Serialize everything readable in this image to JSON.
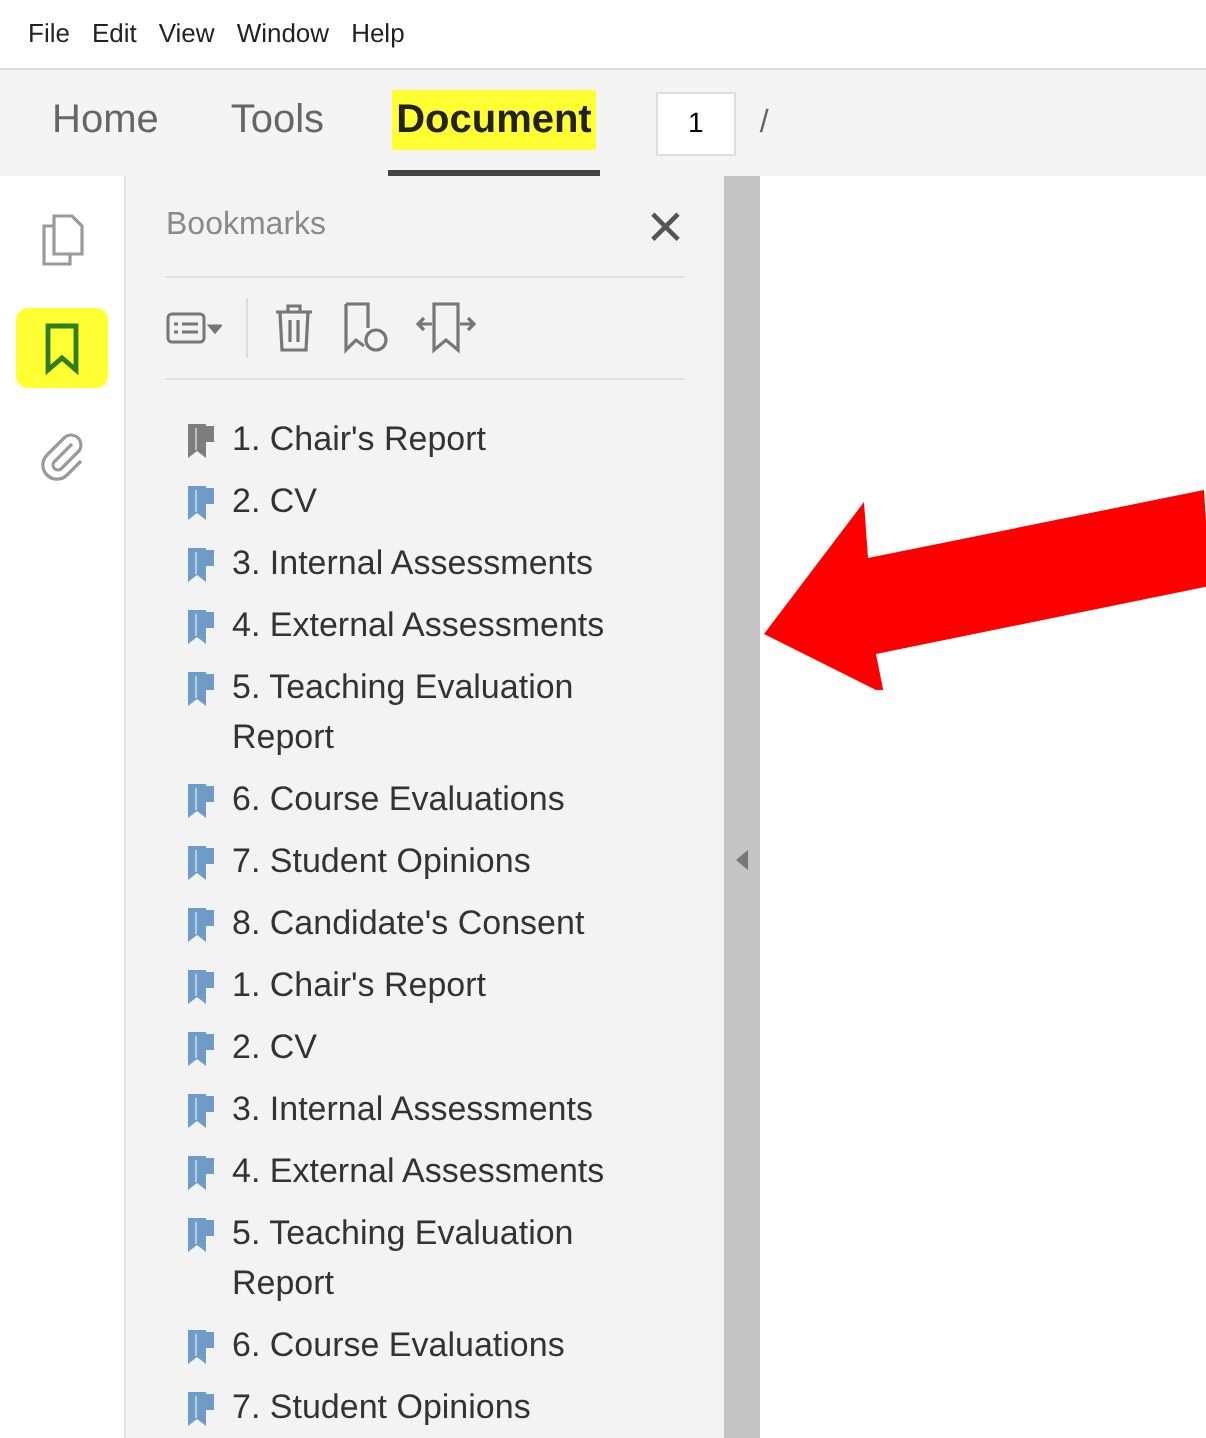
{
  "menu_bar": [
    "File",
    "Edit",
    "View",
    "Window",
    "Help"
  ],
  "tabs": [
    {
      "label": "Home",
      "selected": false,
      "highlighted": false
    },
    {
      "label": "Tools",
      "selected": false,
      "highlighted": false
    },
    {
      "label": "Document",
      "selected": true,
      "highlighted": true
    }
  ],
  "page_field": {
    "value": "1",
    "separator": "/"
  },
  "side_tools": [
    {
      "kind": "pages",
      "selected": false,
      "highlighted": false
    },
    {
      "kind": "bookmarks",
      "selected": true,
      "highlighted": true
    },
    {
      "kind": "attachments",
      "selected": false,
      "highlighted": false
    }
  ],
  "bookmarks_panel": {
    "title": "Bookmarks",
    "close": "×",
    "items": [
      {
        "label": "1. Chair's Report",
        "color": "#7d7d7d"
      },
      {
        "label": "2. CV",
        "color": "#6e9cc6"
      },
      {
        "label": "3. Internal Assessments",
        "color": "#6e9cc6"
      },
      {
        "label": "4. External Assessments",
        "color": "#6e9cc6"
      },
      {
        "label": "5. Teaching Evaluation Report",
        "color": "#6e9cc6"
      },
      {
        "label": "6. Course Evaluations",
        "color": "#6e9cc6"
      },
      {
        "label": "7. Student Opinions",
        "color": "#6e9cc6"
      },
      {
        "label": "8. Candidate's Consent",
        "color": "#6e9cc6"
      },
      {
        "label": "1. Chair's Report",
        "color": "#6e9cc6"
      },
      {
        "label": "2. CV",
        "color": "#6e9cc6"
      },
      {
        "label": "3. Internal Assessments",
        "color": "#6e9cc6"
      },
      {
        "label": "4. External Assessments",
        "color": "#6e9cc6"
      },
      {
        "label": "5. Teaching Evaluation Report",
        "color": "#6e9cc6"
      },
      {
        "label": "6. Course Evaluations",
        "color": "#6e9cc6"
      },
      {
        "label": "7. Student Opinions",
        "color": "#6e9cc6"
      }
    ]
  }
}
